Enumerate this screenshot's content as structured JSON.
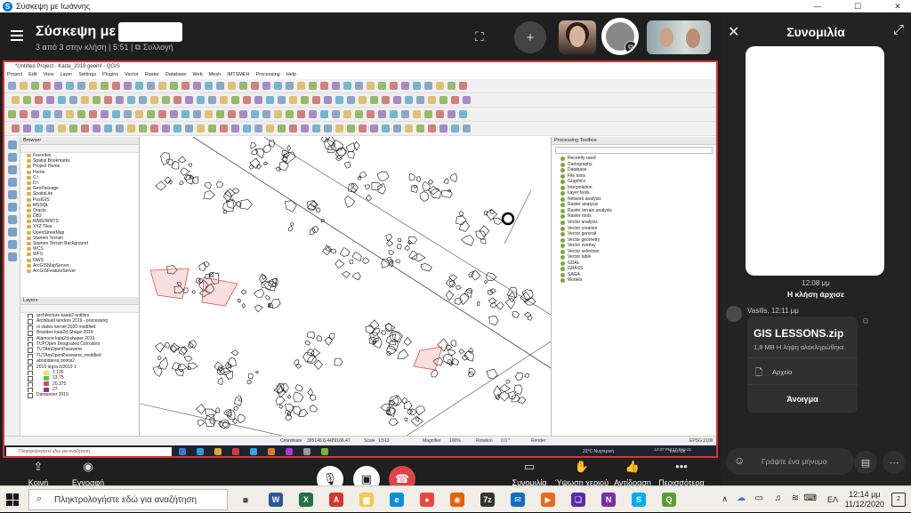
{
  "window": {
    "title": "Σύσκεψη με Ιωάννης",
    "logo": "S",
    "controls": [
      "minimize-icon",
      "maximize-icon",
      "close-icon"
    ]
  },
  "meeting": {
    "title": "Σύσκεψη με",
    "subtitle": "3 από 3 στην κλήση | 5:51 | ⧉ Συλλογή",
    "add_people_icon": "add-person-icon",
    "layout_icon": "layout-icon"
  },
  "shared_screen": {
    "qgis_title": "*Untitled Project - Karta_2019 geoinf - QGIS",
    "menu": [
      "Project",
      "Edit",
      "View",
      "Layer",
      "Settings",
      "Plugins",
      "Vector",
      "Raster",
      "Database",
      "Web",
      "Mesh",
      "IMTSMEH",
      "Processing",
      "Help"
    ],
    "browser": {
      "title": "Browser",
      "items": [
        "Favorites",
        "Spatial Bookmarks",
        "Project Home",
        "Home",
        "C:\\",
        "D:\\",
        "GeoPackage",
        "SpatiaLite",
        "PostGIS",
        "MSSQL",
        "Oracle",
        "DB2",
        "WMS/WMTS",
        "XYZ Tiles",
        "OpenStreetMap",
        "Stamen Terrain",
        "Stamen Terrain Background",
        "WCS",
        "WFS",
        "OWS",
        "ArcGISMapServer",
        "ArcGISFeatureServer"
      ]
    },
    "layers": {
      "title": "Layers",
      "items": [
        "architecture kaiak2 entities",
        "Archibald tenders 2019 - processing",
        "oi states kernel 2020 modified",
        "Branden kaia2d-Shape 2019",
        "Alamone kaia2d-shaper 2019",
        "TUPOpen Desgnated Corrodors",
        "TUTAmOpenPasswere",
        "TUTAmOpenPasswere_modified",
        "abrandarea points2",
        "2019 tegra 0/2019 1",
        "7.125",
        "13.75",
        "20.375",
        "27",
        "Dampener 2019"
      ],
      "swatch_colors": [
        "#e8e84a",
        "#49c95c",
        "#e04a4a",
        "#8a3a8a"
      ]
    },
    "toolbox": {
      "title": "Processing Toolbox",
      "items": [
        "Recently used",
        "Cartography",
        "Database",
        "File tools",
        "Graphics",
        "Interpolation",
        "Layer tools",
        "Network analysis",
        "Raster analysis",
        "Raster terrain analysis",
        "Raster tools",
        "Vector analysis",
        "Vector creation",
        "Vector general",
        "Vector geometry",
        "Vector overlay",
        "Vector selection",
        "Vector table",
        "GDAL",
        "GRASS",
        "SAGA",
        "Models"
      ]
    },
    "status": {
      "coordinate_label": "Coordinate",
      "coordinate": "395146.6,4489166.47",
      "scale_label": "Scale",
      "scale": "1:513",
      "magnifier_label": "Magnifier",
      "magnifier": "100%",
      "rotation_label": "Rotation",
      "rotation": "0.0 °",
      "render": "Render",
      "crs": "EPSG:2100"
    },
    "win_search_placeholder": "Πληκτρολογήστε εδώ για αναζήτηση",
    "win_weather": "22°C Νυχτερινή",
    "win_clock": "12:27 PM 17-Sep-21",
    "win_lang": "ENG US"
  },
  "controls": {
    "share_label": "Κοινή χρήση",
    "record_label": "Εγγραφή",
    "chat_label": "Συνομιλία",
    "raise_hand_label": "Ύψωση χεριού",
    "react_label": "Αντίδραση",
    "more_label": "Περισσότερα"
  },
  "chat": {
    "title": "Συνομιλία",
    "call_time": "12:08 μμ",
    "call_started": "Η κλήση άρχισε",
    "sender": "Vasilis, 12:11 μμ",
    "file_name": "GIS LESSONS.zip",
    "file_info": "1,8 MB Η λήψη ολοκληρώθηκε",
    "file_type": "Αρχείο",
    "open_label": "Άνοιγμα",
    "message_placeholder": "Γράψτε ένα μήνυμα"
  },
  "taskbar": {
    "search_placeholder": "Πληκτρολογήστε εδώ για αναζήτηση",
    "apps": [
      "task-view",
      "word",
      "excel",
      "acrobat",
      "file-explorer",
      "edge",
      "chrome",
      "firefox",
      "7zip",
      "mail",
      "media-player",
      "photos",
      "onenote",
      "skype",
      "qgis"
    ],
    "language": "ΕΛ",
    "time": "12:14 μμ",
    "date": "11/12/2020",
    "notifications": "2"
  }
}
